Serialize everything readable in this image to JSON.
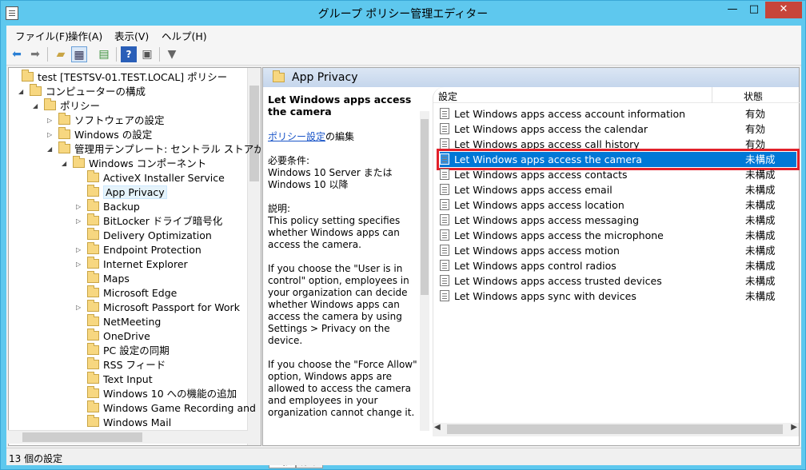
{
  "window": {
    "title": "グループ ポリシー管理エディター",
    "min_label": "—",
    "max_label": "□",
    "close_label": "✕"
  },
  "menu": [
    "ファイル(F)",
    "操作(A)",
    "表示(V)",
    "ヘルプ(H)"
  ],
  "toolbar": {
    "icons": [
      "back-arrow-icon",
      "forward-arrow-icon",
      "up-folder-icon",
      "show-hide-tree-icon",
      "export-icon",
      "help-icon",
      "properties-icon",
      "filter-icon"
    ]
  },
  "tree": {
    "items": [
      {
        "label": "test [TESTSV-01.TEST.LOCAL] ポリシー",
        "level": 0,
        "tri": ""
      },
      {
        "label": "コンピューターの構成",
        "level": 1,
        "tri": "◢"
      },
      {
        "label": "ポリシー",
        "level": 2,
        "tri": "◢"
      },
      {
        "label": "ソフトウェアの設定",
        "level": 3,
        "tri": "▷"
      },
      {
        "label": "Windows の設定",
        "level": 3,
        "tri": "▷"
      },
      {
        "label": "管理用テンプレート: セントラル ストアから取得",
        "level": 3,
        "tri": "◢"
      },
      {
        "label": "Windows コンポーネント",
        "level": 4,
        "tri": "◢"
      },
      {
        "label": "ActiveX Installer Service",
        "level": 5,
        "tri": ""
      },
      {
        "label": "App Privacy",
        "level": 5,
        "tri": "",
        "selected": true
      },
      {
        "label": "Backup",
        "level": 5,
        "tri": "▷"
      },
      {
        "label": "BitLocker ドライブ暗号化",
        "level": 5,
        "tri": "▷"
      },
      {
        "label": "Delivery Optimization",
        "level": 5,
        "tri": ""
      },
      {
        "label": "Endpoint Protection",
        "level": 5,
        "tri": "▷"
      },
      {
        "label": "Internet Explorer",
        "level": 5,
        "tri": "▷"
      },
      {
        "label": "Maps",
        "level": 5,
        "tri": ""
      },
      {
        "label": "Microsoft Edge",
        "level": 5,
        "tri": ""
      },
      {
        "label": "Microsoft Passport for Work",
        "level": 5,
        "tri": "▷"
      },
      {
        "label": "NetMeeting",
        "level": 5,
        "tri": ""
      },
      {
        "label": "OneDrive",
        "level": 5,
        "tri": ""
      },
      {
        "label": "PC 設定の同期",
        "level": 5,
        "tri": ""
      },
      {
        "label": "RSS フィード",
        "level": 5,
        "tri": ""
      },
      {
        "label": "Text Input",
        "level": 5,
        "tri": ""
      },
      {
        "label": "Windows 10 への機能の追加",
        "level": 5,
        "tri": ""
      },
      {
        "label": "Windows Game Recording and",
        "level": 5,
        "tri": ""
      },
      {
        "label": "Windows Mail",
        "level": 5,
        "tri": ""
      }
    ]
  },
  "pane": {
    "header": "App Privacy"
  },
  "description": {
    "title": "Let Windows apps access the camera",
    "link": "ポリシー設定",
    "link_suffix": "の編集",
    "req_label": "必要条件:",
    "req_text": "Windows 10 Server または Windows 10 以降",
    "desc_label": "説明:",
    "para1": "This policy setting specifies whether Windows apps can access the camera.",
    "para2": "If you choose the \"User is in control\" option, employees in your organization can decide whether Windows apps can access the camera by using Settings > Privacy on the device.",
    "para3": "If you choose the \"Force Allow\" option, Windows apps are allowed to access the camera and employees in your organization cannot change it."
  },
  "list": {
    "col_setting": "設定",
    "col_state": "状態",
    "rows": [
      {
        "name": "Let Windows apps access account information",
        "state": "有効"
      },
      {
        "name": "Let Windows apps access the calendar",
        "state": "有効"
      },
      {
        "name": "Let Windows apps access call history",
        "state": "有効"
      },
      {
        "name": "Let Windows apps access the camera",
        "state": "未構成",
        "highlight": true
      },
      {
        "name": "Let Windows apps access contacts",
        "state": "未構成"
      },
      {
        "name": "Let Windows apps access email",
        "state": "未構成"
      },
      {
        "name": "Let Windows apps access location",
        "state": "未構成"
      },
      {
        "name": "Let Windows apps access messaging",
        "state": "未構成"
      },
      {
        "name": "Let Windows apps access the microphone",
        "state": "未構成"
      },
      {
        "name": "Let Windows apps access motion",
        "state": "未構成"
      },
      {
        "name": "Let Windows apps control radios",
        "state": "未構成"
      },
      {
        "name": "Let Windows apps access trusted devices",
        "state": "未構成"
      },
      {
        "name": "Let Windows apps sync with devices",
        "state": "未構成"
      }
    ]
  },
  "tabs": [
    "拡張",
    "標準"
  ],
  "status": {
    "text": "13 個の設定"
  },
  "colors": {
    "titlebar": "#5ec8ee",
    "selection": "#0078d7",
    "highlight_border": "#e2202a"
  }
}
